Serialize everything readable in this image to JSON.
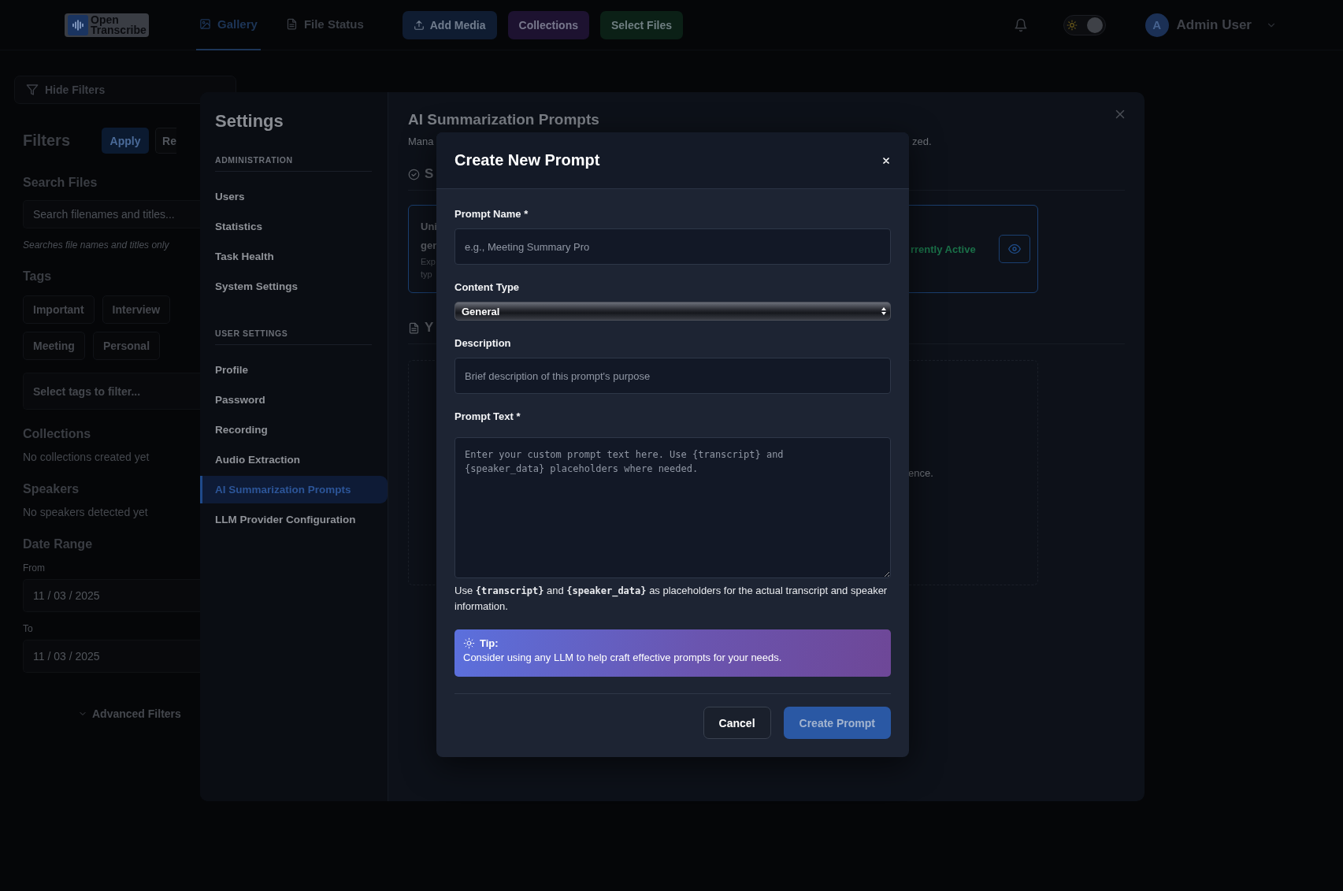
{
  "topbar": {
    "logo_text": "Open Transcribe",
    "nav": [
      {
        "label": "Gallery",
        "selected": true
      },
      {
        "label": "File Status",
        "selected": false
      }
    ],
    "theme_toggle": {
      "on": true
    },
    "actions": [
      {
        "label": "Add Media",
        "color": "#0f1c31"
      },
      {
        "label": "Collections",
        "color": "#1d1230"
      },
      {
        "label": "Select Files",
        "color": "#0b2016"
      }
    ],
    "user": {
      "avatar": "A",
      "name": "Admin User"
    }
  },
  "filters": {
    "toggle": "Hide Filters",
    "title": "Filters",
    "apply": "Apply",
    "reset": "Re",
    "search": {
      "heading": "Search Files",
      "placeholder": "Search filenames and titles...",
      "hint": "Searches file names and titles only"
    },
    "tags": {
      "heading": "Tags",
      "chips": [
        "Important",
        "Interview",
        "Meeting",
        "Personal"
      ],
      "placeholder": "Select tags to filter..."
    },
    "collections": {
      "heading": "Collections",
      "empty": "No collections created yet"
    },
    "speakers": {
      "heading": "Speakers",
      "empty": "No speakers detected yet"
    },
    "date_range": {
      "heading": "Date Range",
      "fields": [
        {
          "label": "From",
          "value": "11 / 03 / 2025"
        },
        {
          "label": "To",
          "value": "11 / 03 / 2025"
        }
      ]
    },
    "advanced": "Advanced Filters"
  },
  "settings": {
    "title": "Settings",
    "groups": [
      {
        "heading": "ADMINISTRATION",
        "items": [
          {
            "label": "Users",
            "selected": false
          },
          {
            "label": "Statistics",
            "selected": false
          },
          {
            "label": "Task Health",
            "selected": false
          },
          {
            "label": "System Settings",
            "selected": false
          }
        ]
      },
      {
        "heading": "USER SETTINGS",
        "items": [
          {
            "label": "Profile",
            "selected": false
          },
          {
            "label": "Password",
            "selected": false
          },
          {
            "label": "Recording",
            "selected": false
          },
          {
            "label": "Audio Extraction",
            "selected": false
          },
          {
            "label": "AI Summarization Prompts",
            "selected": true
          },
          {
            "label": "LLM Provider Configuration",
            "selected": false
          }
        ]
      }
    ],
    "content": {
      "title": "AI Summarization Prompts",
      "subtitle_start": "Mana",
      "subtitle_end": "zed.",
      "section_1": "S",
      "card": {
        "lines": [
          "Uni",
          "ger"
        ],
        "small_lines": [
          "Exp",
          "typ"
        ],
        "status": "rrently Active"
      },
      "section_2": "Y",
      "empty_end": "ence."
    }
  },
  "dialog": {
    "title": "Create New Prompt",
    "fields": [
      {
        "kind": "input",
        "label": "Prompt Name *",
        "placeholder": "e.g., Meeting Summary Pro"
      },
      {
        "kind": "select",
        "label": "Content Type",
        "value": "General"
      },
      {
        "kind": "input",
        "label": "Description",
        "placeholder": "Brief description of this prompt's purpose"
      },
      {
        "kind": "textarea",
        "label": "Prompt Text *",
        "placeholder": "Enter your custom prompt text here. Use {transcript} and\n{speaker_data} placeholders where needed."
      }
    ],
    "help": [
      {
        "kind": "text",
        "text": "Use "
      },
      {
        "kind": "code",
        "text": "{transcript}"
      },
      {
        "kind": "text",
        "text": " and "
      },
      {
        "kind": "code",
        "text": "{speaker_data}"
      },
      {
        "kind": "text",
        "text": " as placeholders for the actual transcript and speaker information."
      }
    ],
    "tip": {
      "title": "Tip:",
      "text": "Consider using any LLM to help craft effective prompts for your needs."
    },
    "buttons": [
      {
        "kind": "secondary",
        "label": "Cancel"
      },
      {
        "kind": "primary",
        "label": "Create Prompt"
      }
    ]
  }
}
